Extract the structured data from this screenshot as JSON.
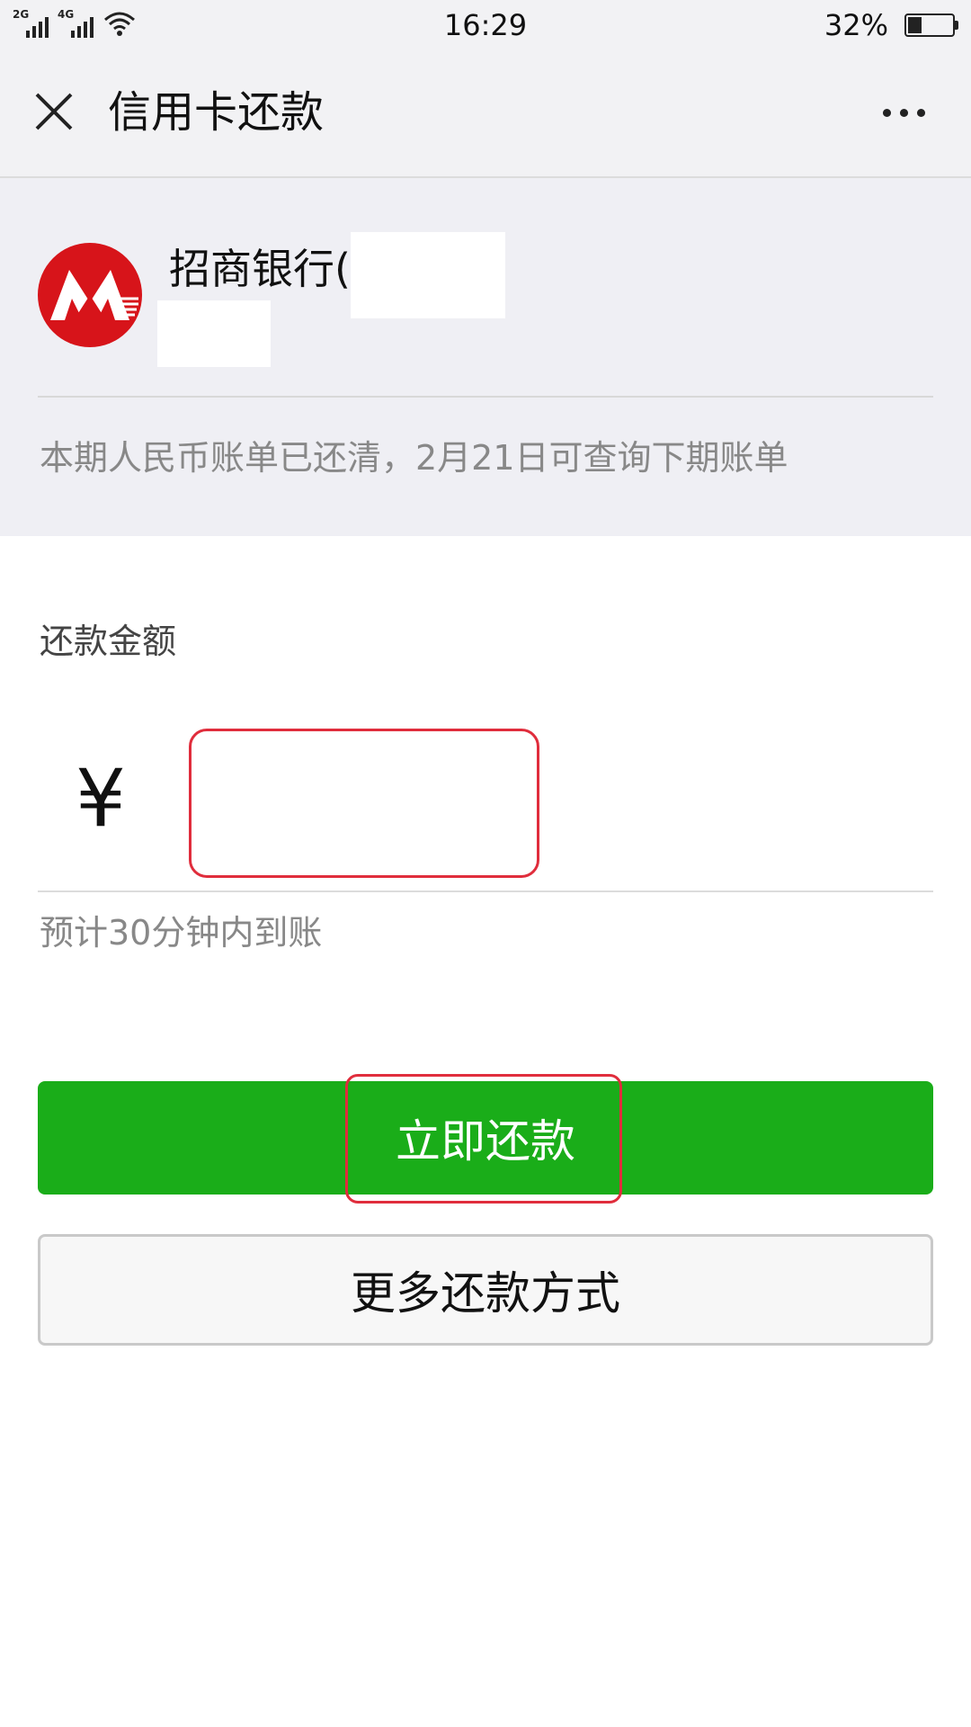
{
  "status_bar": {
    "network_1": "2G",
    "network_2": "4G",
    "time": "16:29",
    "battery_percent": "32%",
    "battery_level": 0.32
  },
  "nav": {
    "title": "信用卡还款",
    "close_icon": "close-icon",
    "more_icon": "more-dots-icon"
  },
  "card": {
    "bank_name": "招商银行(",
    "bank_logo_icon": "cmb-logo",
    "bill_status": "本期人民币账单已还清，2月21日可查询下期账单"
  },
  "repayment": {
    "amount_label": "还款金额",
    "currency_symbol": "¥",
    "amount_value": "",
    "arrival_hint": "预计30分钟内到账"
  },
  "actions": {
    "pay_label": "立即还款",
    "more_methods_label": "更多还款方式"
  },
  "colors": {
    "primary_green": "#1aad19",
    "highlight_red": "#e02d3c",
    "bank_red": "#d7141a"
  }
}
